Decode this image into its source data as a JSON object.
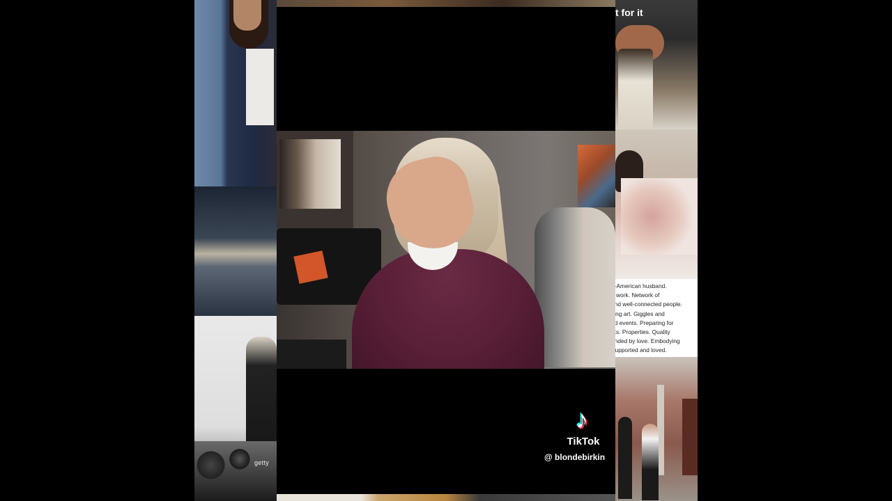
{
  "collage": {
    "top_right_text": "t for it",
    "getty_text": "getty",
    "caption_lines": [
      "n-American husband.",
      "g work. Network of",
      "and well-connected people.",
      "king art. Giggles and",
      "nd events. Preparing for",
      "nts. Properties. Quality",
      "unded by love. Embodying",
      "Supported and loved."
    ]
  },
  "watermark": {
    "icon": "tiktok-note-icon",
    "brand": "TikTok",
    "username": "@ blondebirkin"
  },
  "colors": {
    "background": "#000000",
    "tiktok_cyan": "#25F4EE",
    "tiktok_red": "#FE2C55",
    "sweater": "#5a2038"
  }
}
